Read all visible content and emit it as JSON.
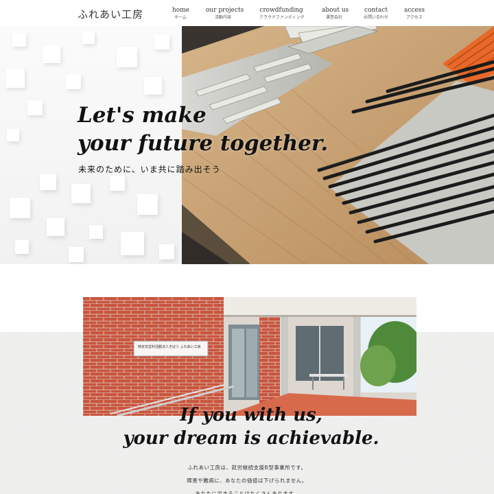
{
  "header": {
    "logo": "ふれあい工房",
    "nav": [
      {
        "en": "home",
        "ja": "ホーム"
      },
      {
        "en": "our projects",
        "ja": "活動内容"
      },
      {
        "en": "crowdfunding",
        "ja": "クラウドファンディング"
      },
      {
        "en": "about us",
        "ja": "運営会社"
      },
      {
        "en": "contact",
        "ja": "お問い合わせ"
      },
      {
        "en": "access",
        "ja": "アクセス"
      }
    ]
  },
  "hero": {
    "headline_line1": "Let's make",
    "headline_line2": "your future together.",
    "subheading": "未来のために、いま共に踏み出そう",
    "photo_icon": "workshop-photo"
  },
  "building": {
    "sign_text": "特定非営利活動法人きぼう ふれあい工房",
    "photo_icon": "building-photo"
  },
  "cta": {
    "headline_line1": "If you with us,",
    "headline_line2": "your dream is achievable."
  },
  "intro": {
    "lines": [
      "ふれあい工房は、就労継続支援B型事業所です。",
      "障害や難病に、あなたの価値は下げられません。",
      "あなたにできることはたくさんあります。"
    ]
  },
  "colors": {
    "text": "#111111",
    "brick": "#c8553e",
    "wood": "#c9a57a",
    "accent_orange": "#e8682a"
  }
}
